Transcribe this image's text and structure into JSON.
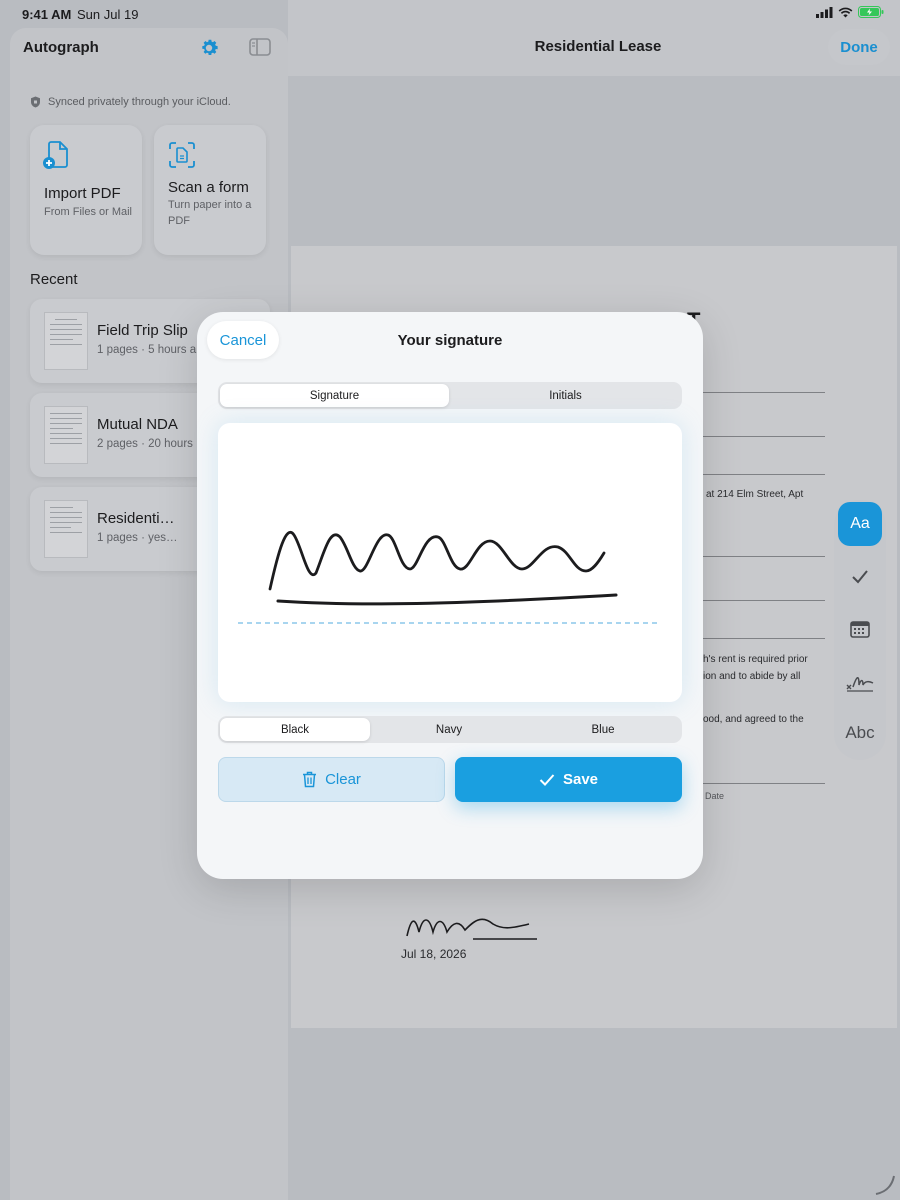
{
  "status_bar": {
    "time": "9:41 AM",
    "date": "Sun Jul 19"
  },
  "sidebar": {
    "title": "Autograph",
    "synced_note": "Synced privately through your iCloud.",
    "actions": [
      {
        "title": "Import PDF",
        "subtitle": "From Files or Mail",
        "icon": "import-pdf-icon"
      },
      {
        "title": "Scan a form",
        "subtitle": "Turn paper into a PDF",
        "icon": "scan-icon"
      }
    ],
    "recent_label": "Recent",
    "recent": [
      {
        "name": "Field Trip Slip",
        "meta": "1 pages · 5 hours a"
      },
      {
        "name": "Mutual NDA",
        "meta": "2 pages · 20 hours"
      },
      {
        "name": "Residenti…",
        "meta": "1 pages · yes…"
      }
    ]
  },
  "main": {
    "title": "Residential Lease",
    "done_label": "Done",
    "page": {
      "heading_fragment": "T",
      "text_lines": [
        "at 214 Elm Street, Apt",
        "h's rent is required prior",
        "ion and to abide by all",
        "ood, and agreed to the",
        "Date"
      ],
      "signed_date": "Jul 18, 2026"
    },
    "tools": {
      "text_label": "Aa",
      "abc_label": "Abc"
    }
  },
  "modal": {
    "cancel_label": "Cancel",
    "title": "Your signature",
    "tabs": [
      "Signature",
      "Initials"
    ],
    "active_tab": "Signature",
    "colors": [
      "Black",
      "Navy",
      "Blue"
    ],
    "active_color": "Black",
    "clear_label": "Clear",
    "save_label": "Save"
  },
  "colors": {
    "accent": "#1a95d8",
    "save_button": "#1a9fe0",
    "ink": "#1c1c1e"
  }
}
